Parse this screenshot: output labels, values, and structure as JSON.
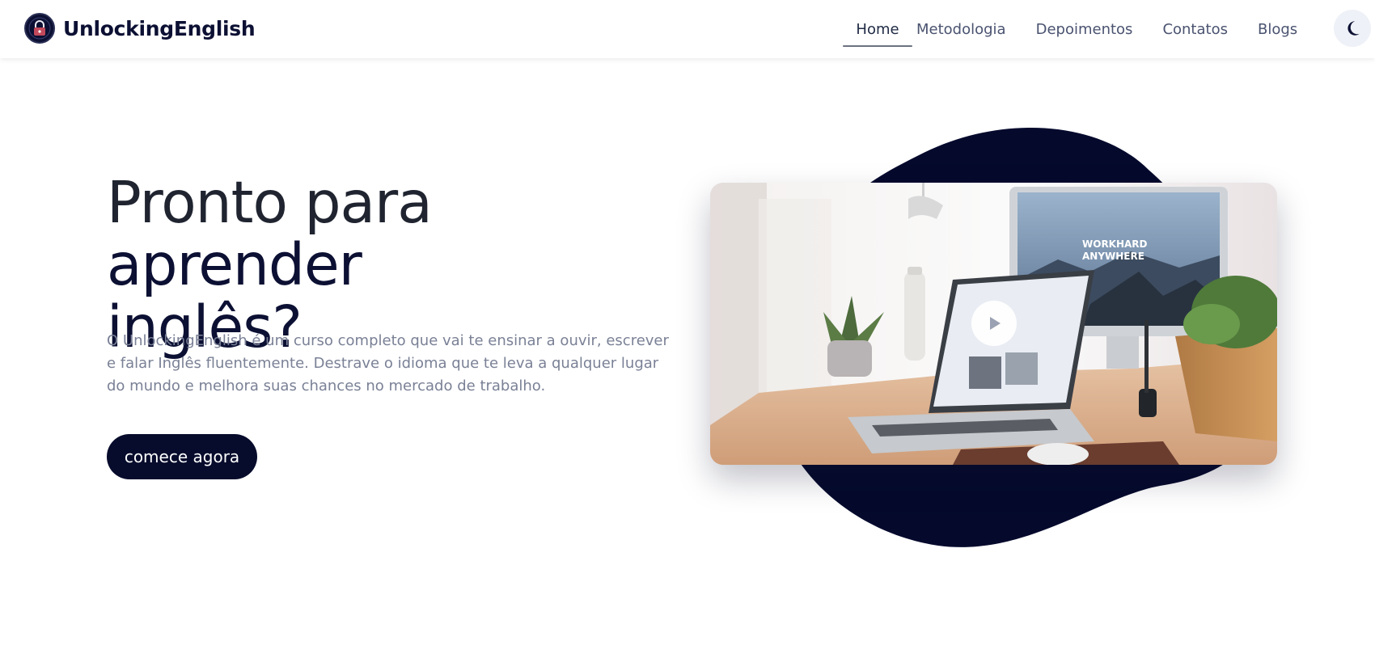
{
  "brand": {
    "name": "UnlockingEnglish",
    "logo_icon": "lock-logo-icon"
  },
  "nav": {
    "items": [
      {
        "label": "Home",
        "active": true
      },
      {
        "label": "Metodologia",
        "active": false
      },
      {
        "label": "Depoimentos",
        "active": false
      },
      {
        "label": "Contatos",
        "active": false
      },
      {
        "label": "Blogs",
        "active": false
      }
    ],
    "theme_toggle_icon": "moon-icon"
  },
  "hero": {
    "title_line1": "Pronto para",
    "title_line2": "aprender inglês?",
    "description": "O UnlockingEnglish é um curso completo que vai te ensinar a ouvir, escrever e falar Inglês fluentemente. Destrave o idioma que te leva a qualquer lugar do mundo e melhora suas chances no mercado de trabalho.",
    "cta_label": "comece agora"
  },
  "video": {
    "screen_text_line1": "WORKHARD",
    "screen_text_line2": "ANYWHERE",
    "play_icon": "play-icon"
  },
  "colors": {
    "primary": "#070c2c",
    "text_muted": "#7a8196",
    "nav_text": "#4a5370",
    "toggle_bg": "#eef1f7"
  }
}
